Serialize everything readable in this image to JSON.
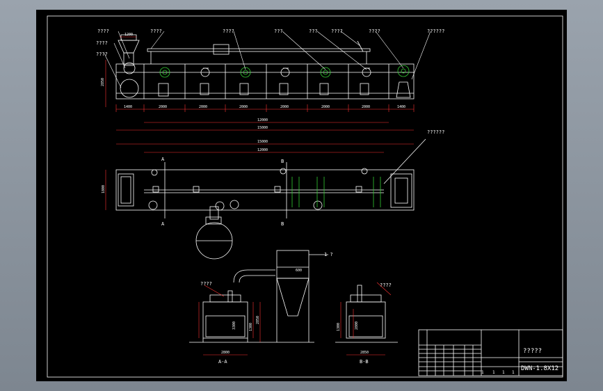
{
  "drawing": {
    "title_placeholder": "?????",
    "drawing_number": "DWN-1.8X12",
    "top_labels": [
      "????",
      "????",
      "????",
      "????",
      "???",
      "???",
      "????",
      "????",
      "??????"
    ],
    "left_labels": [
      "????",
      "????",
      "????"
    ],
    "hopper_width": "1200",
    "side_height": "2850",
    "segment_dims": [
      "1400",
      "2000",
      "2000",
      "2000",
      "2000",
      "2000",
      "2000",
      "1400"
    ],
    "overall_dim_1": "12000",
    "overall_dim_2": "15000",
    "plan_label": "??????",
    "plan_overall_dim": "15000",
    "plan_inner_dim": "12000",
    "plan_height": "1800",
    "section_marks": [
      "A",
      "A",
      "B",
      "B"
    ],
    "fan_duct_dim": "600",
    "note_label": "1 ?",
    "section_a_label": "????",
    "section_b_label": "????",
    "section_a_dims": [
      "2850",
      "3300",
      "1300",
      "2800"
    ],
    "section_b_dims": [
      "1300",
      "2800",
      "2850"
    ],
    "section_names": [
      "A-A",
      "B-B"
    ],
    "title_block_marks": [
      "1",
      "1",
      "1",
      "1"
    ]
  }
}
